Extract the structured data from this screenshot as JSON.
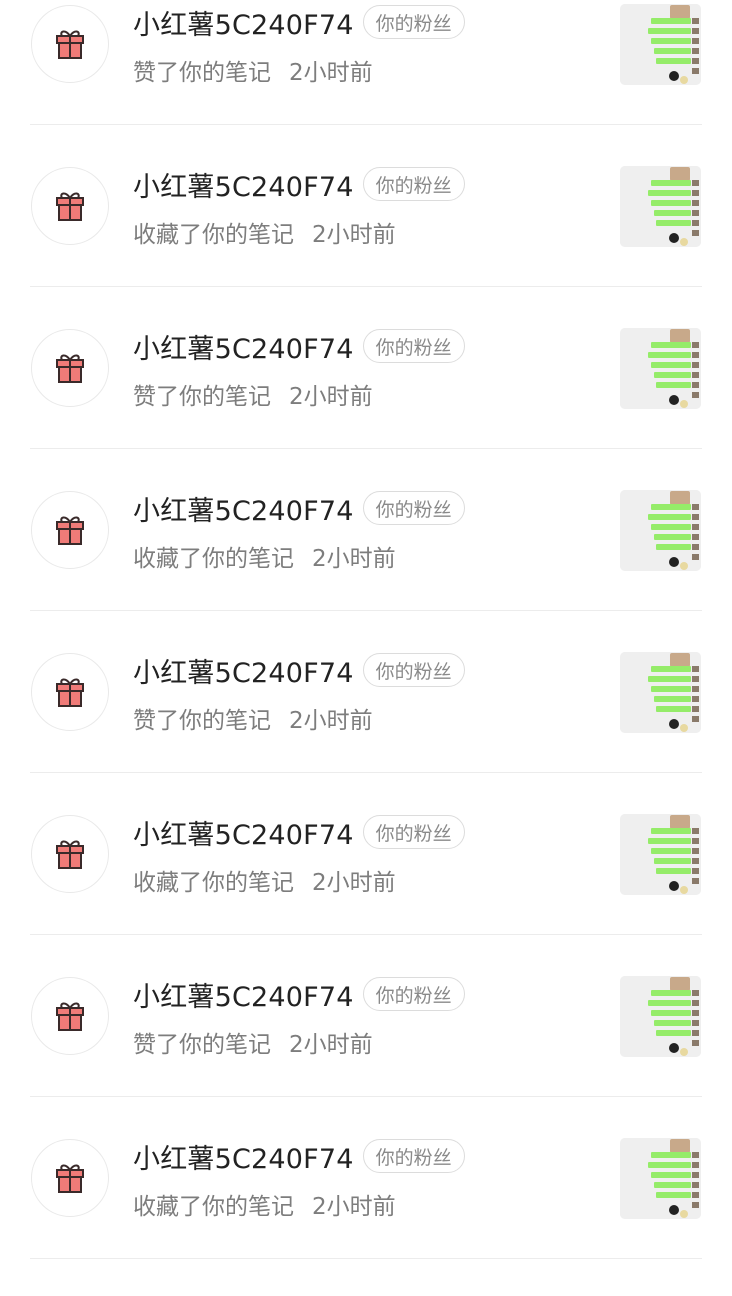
{
  "colors": {
    "gift_red": "#f07b78",
    "bubble_green": "#95ec69"
  },
  "items": [
    {
      "user": "小红薯5C240F74",
      "badge": "你的粉丝",
      "action": "赞了你的笔记",
      "time": "2小时前",
      "avatar_icon": "gift-icon",
      "thumb": "chat-screenshot-thumbnail"
    },
    {
      "user": "小红薯5C240F74",
      "badge": "你的粉丝",
      "action": "收藏了你的笔记",
      "time": "2小时前",
      "avatar_icon": "gift-icon",
      "thumb": "chat-screenshot-thumbnail"
    },
    {
      "user": "小红薯5C240F74",
      "badge": "你的粉丝",
      "action": "赞了你的笔记",
      "time": "2小时前",
      "avatar_icon": "gift-icon",
      "thumb": "chat-screenshot-thumbnail"
    },
    {
      "user": "小红薯5C240F74",
      "badge": "你的粉丝",
      "action": "收藏了你的笔记",
      "time": "2小时前",
      "avatar_icon": "gift-icon",
      "thumb": "chat-screenshot-thumbnail"
    },
    {
      "user": "小红薯5C240F74",
      "badge": "你的粉丝",
      "action": "赞了你的笔记",
      "time": "2小时前",
      "avatar_icon": "gift-icon",
      "thumb": "chat-screenshot-thumbnail"
    },
    {
      "user": "小红薯5C240F74",
      "badge": "你的粉丝",
      "action": "收藏了你的笔记",
      "time": "2小时前",
      "avatar_icon": "gift-icon",
      "thumb": "chat-screenshot-thumbnail"
    },
    {
      "user": "小红薯5C240F74",
      "badge": "你的粉丝",
      "action": "赞了你的笔记",
      "time": "2小时前",
      "avatar_icon": "gift-icon",
      "thumb": "chat-screenshot-thumbnail"
    },
    {
      "user": "小红薯5C240F74",
      "badge": "你的粉丝",
      "action": "收藏了你的笔记",
      "time": "2小时前",
      "avatar_icon": "gift-icon",
      "thumb": "chat-screenshot-thumbnail"
    }
  ]
}
